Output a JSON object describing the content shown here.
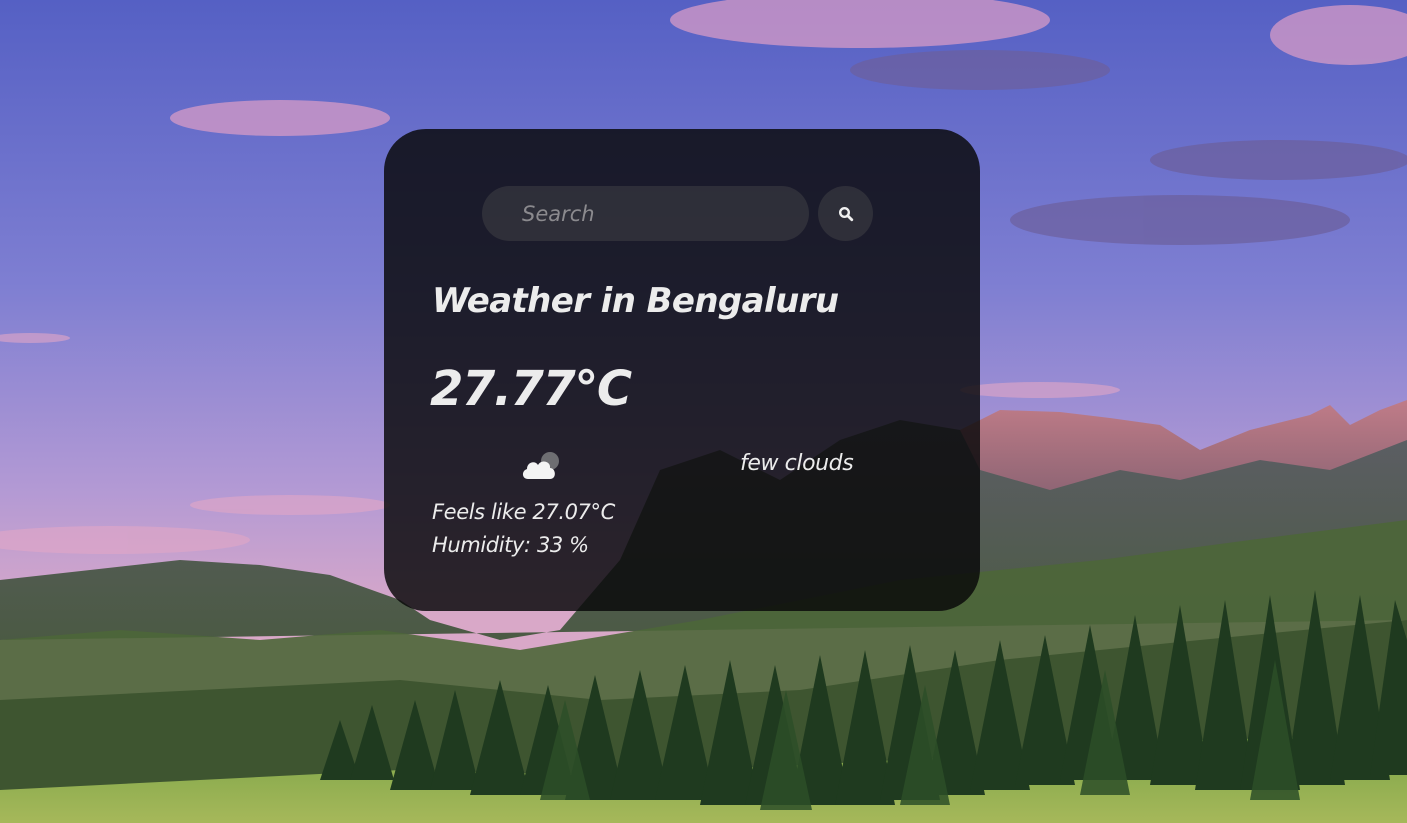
{
  "search": {
    "placeholder": "Search",
    "value": "",
    "button_icon": "search-icon"
  },
  "weather": {
    "title": "Weather in Bengaluru",
    "temperature": "27.77°C",
    "icon": "few-clouds-icon",
    "description": "few clouds",
    "feels_like": "Feels like 27.07°C",
    "humidity": "Humidity: 33 %"
  },
  "colors": {
    "card_background": "#08080a",
    "text": "#ececec",
    "input_background": "#404046",
    "sky_top": "#5b66c8",
    "sky_bottom": "#b79ad4",
    "meadow": "#6e9a3c"
  }
}
